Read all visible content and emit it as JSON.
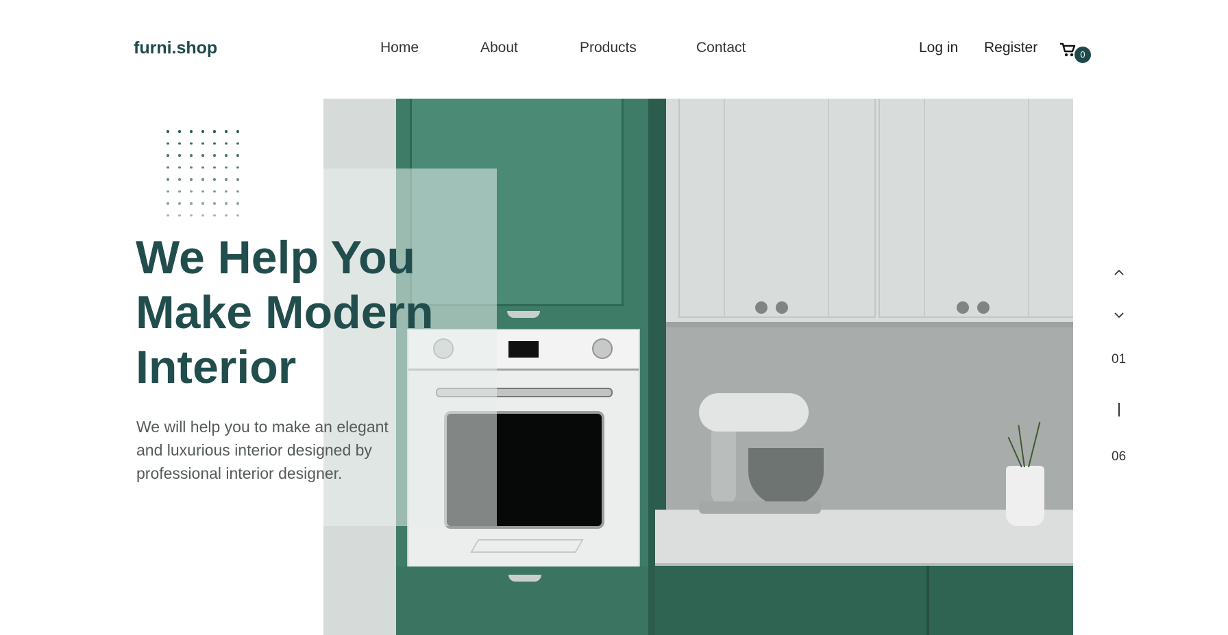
{
  "header": {
    "logo": "furni.shop",
    "nav": [
      "Home",
      "About",
      "Products",
      "Contact"
    ],
    "login": "Log in",
    "register": "Register",
    "cart_icon": "cart-icon",
    "cart_count": "0"
  },
  "hero": {
    "headline": [
      "We Help You",
      "Make Modern",
      "Interior"
    ],
    "subtext": [
      "We will help you to make an elegant",
      "and luxurious interior designed by",
      "professional interior designer."
    ],
    "image_subject": "green kitchen with oven and stand mixer"
  },
  "slider": {
    "up_icon": "chevron-up-icon",
    "down_icon": "chevron-down-icon",
    "current": "01",
    "separator": "|",
    "total": "06"
  },
  "colors": {
    "brand": "#224d4d",
    "text": "#555a5a",
    "badge": "#1f4a4a"
  }
}
